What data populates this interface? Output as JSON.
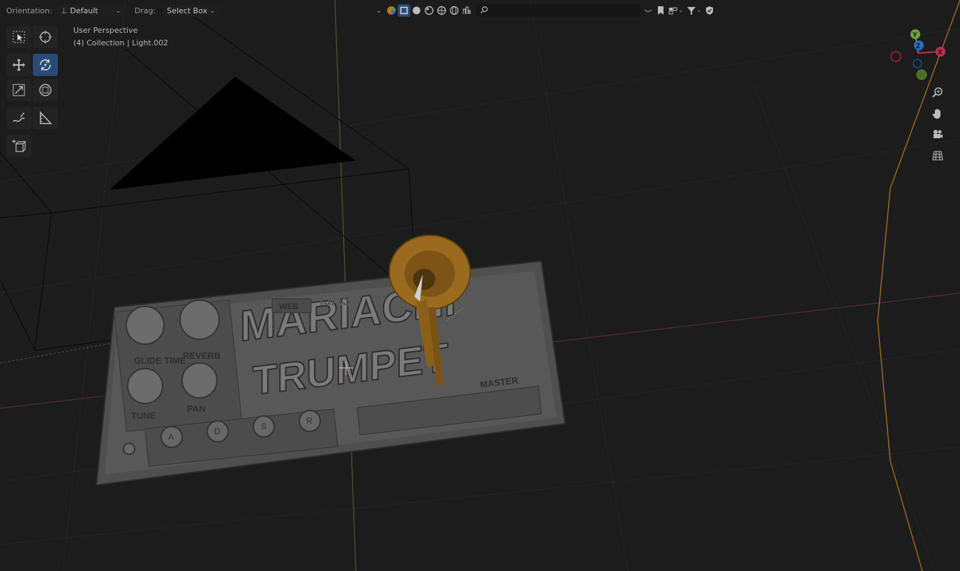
{
  "header": {
    "orientation_label": "Orientation:",
    "orientation_value": "Default",
    "drag_label": "Drag:",
    "drag_value": "Select Box",
    "search_placeholder": ""
  },
  "overlay": {
    "view_name": "User Perspective",
    "collection_info": "(4) Collection | Light.002"
  },
  "model": {
    "title_line1": "MARIACHI",
    "title_line2": "TRUMPET",
    "knob_labels": [
      "GLIDE TIME",
      "REVERB",
      "TUNE",
      "PAN"
    ],
    "adsr_labels": [
      "A",
      "D",
      "S",
      "R"
    ],
    "web_label": "WEB",
    "master_label": "MASTER"
  },
  "gizmo": {
    "y_label": "Y",
    "z_label": "Z",
    "x_label": "X",
    "x_color": "#c0324a",
    "y_color": "#6fa23a",
    "z_color": "#2f6cc0"
  },
  "colors": {
    "accent": "#2b4a78",
    "trumpet": "#b07a22"
  },
  "icons": {
    "select": "select-box-icon",
    "cursor": "cursor-icon",
    "move": "move-icon",
    "rotate": "rotate-icon",
    "scale": "scale-icon",
    "transform": "transform-icon",
    "annotate": "annotate-icon",
    "measure": "measure-icon",
    "add_cube": "add-cube-icon",
    "zoom": "zoom-icon",
    "pan": "hand-icon",
    "camera": "camera-icon",
    "ortho": "grid-icon"
  }
}
